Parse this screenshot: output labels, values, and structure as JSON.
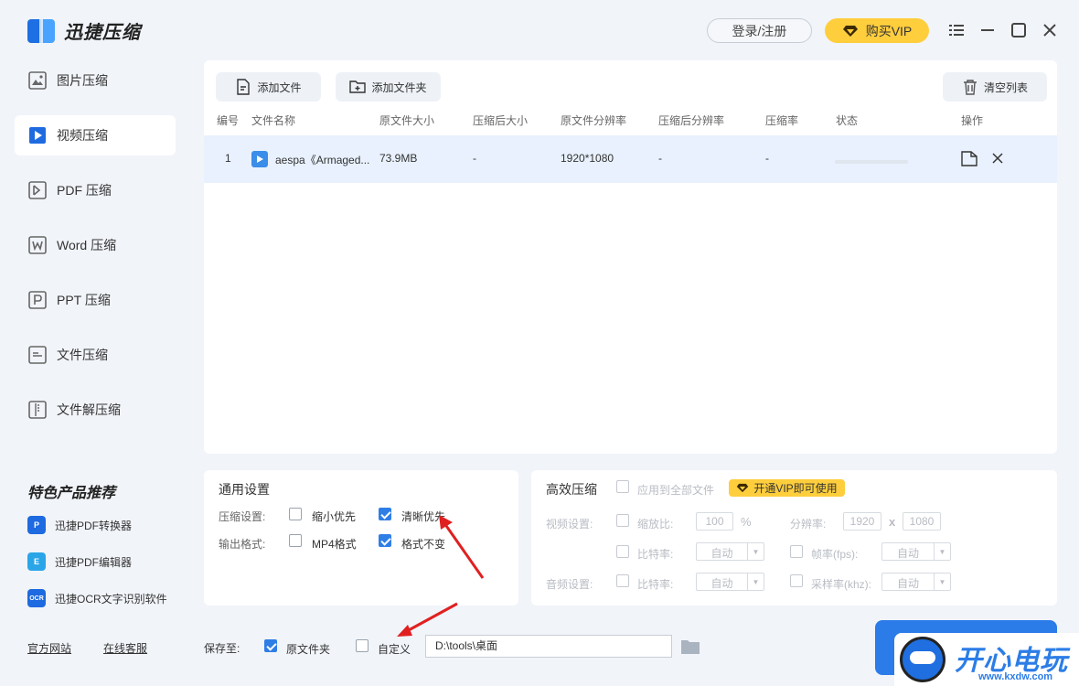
{
  "app": {
    "title": "迅捷压缩"
  },
  "header": {
    "login": "登录/注册",
    "vip": "购买VIP"
  },
  "sidebar": {
    "items": [
      {
        "label": "图片压缩",
        "icon": "image-file-icon"
      },
      {
        "label": "视频压缩",
        "icon": "video-file-icon",
        "active": true
      },
      {
        "label": "PDF 压缩",
        "icon": "pdf-file-icon"
      },
      {
        "label": "Word 压缩",
        "icon": "word-file-icon"
      },
      {
        "label": "PPT 压缩",
        "icon": "ppt-file-icon"
      },
      {
        "label": "文件压缩",
        "icon": "archive-file-icon"
      },
      {
        "label": "文件解压缩",
        "icon": "unzip-file-icon"
      }
    ],
    "promo_title": "特色产品推荐",
    "promo": [
      {
        "label": "迅捷PDF转换器",
        "badge": "P"
      },
      {
        "label": "迅捷PDF编辑器",
        "badge": "E"
      },
      {
        "label": "迅捷OCR文字识别软件",
        "badge": "OCR"
      }
    ],
    "footer": {
      "site": "官方网站",
      "support": "在线客服"
    }
  },
  "toolbar": {
    "add_file": "添加文件",
    "add_folder": "添加文件夹",
    "clear_list": "清空列表"
  },
  "table": {
    "columns": [
      "编号",
      "文件名称",
      "原文件大小",
      "压缩后大小",
      "原文件分辨率",
      "压缩后分辨率",
      "压缩率",
      "状态",
      "操作"
    ],
    "rows": [
      {
        "no": "1",
        "name": "aespa《Armaged...",
        "orig_size": "73.9MB",
        "new_size": "-",
        "orig_res": "1920*1080",
        "new_res": "-",
        "ratio": "-"
      }
    ]
  },
  "general": {
    "title": "通用设置",
    "compress_label": "压缩设置:",
    "opt_small": "缩小优先",
    "opt_clear": "清晰优先",
    "format_label": "输出格式:",
    "opt_mp4": "MP4格式",
    "opt_keep": "格式不变"
  },
  "advanced": {
    "title": "高效压缩",
    "apply_all": "应用到全部文件",
    "vip_tag": "开通VIP即可使用",
    "video_label": "视频设置:",
    "scale": "缩放比:",
    "scale_value": "100",
    "percent": "%",
    "resolution": "分辨率:",
    "res_w": "1920",
    "res_x": "x",
    "res_h": "1080",
    "bitrate": "比特率:",
    "auto": "自动",
    "framerate": "帧率(fps):",
    "audio_label": "音频设置:",
    "audio_bitrate": "比特率:",
    "samplerate": "采样率(khz):"
  },
  "save": {
    "label": "保存至:",
    "orig_folder": "原文件夹",
    "custom": "自定义",
    "path": "D:\\tools\\桌面"
  },
  "watermark": {
    "text": "开心电玩",
    "url": "www.kxdw.com"
  },
  "colors": {
    "accent": "#2b7ce9",
    "vip": "#ffce3d",
    "annotation": "#e02020"
  }
}
